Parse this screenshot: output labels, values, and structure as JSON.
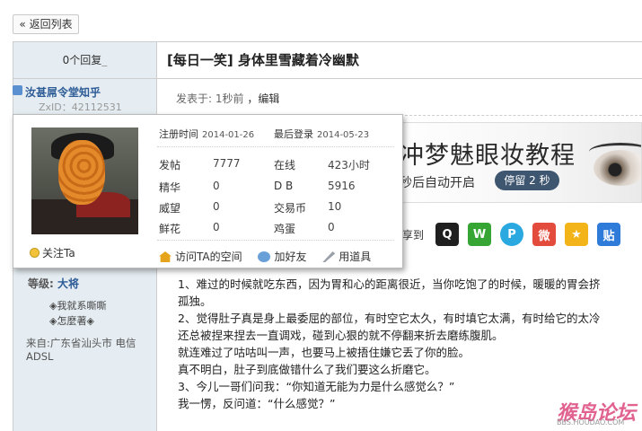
{
  "nav": {
    "back_label": "« 返回列表"
  },
  "thread": {
    "reply_count": "0个回复",
    "title": "[每日一笑] 身体里雪藏着冷幽默"
  },
  "user": {
    "name": "汝甚屌令堂知乎",
    "zxid": "ZxID：42112531",
    "rank_label": "等级:",
    "rank_value": "大将",
    "medals": [
      "◈我就系嘶嘶",
      "◈怎麼著◈"
    ],
    "from": "来自:广东省汕头市 电信ADSL"
  },
  "post": {
    "posted": "发表于: 1秒前",
    "edit": "，编辑",
    "share_label": "享到",
    "lines": [
      "1、难过的时候就吃东西，因为胃和心的距离很近，当你吃饱了的时候，暖暖的胃会挤",
      "孤独。",
      "2、觉得肚子真是身上最委屈的部位，有时空它太久，有时填它太满，有时给它的太冷",
      "还总被捏来捏去一直调戏，碰到心狠的就不停翻来折去磨练腹肌。",
      "就连难过了咕咕叫一声，也要马上被捂住嫌它丢了你的脸。",
      "真不明白，肚子到底做错什么了我们要这么折磨它。",
      "3、今儿一哥们问我：“你知道无能为力是什么感觉么？”",
      "我一愣，反问道：“什么感觉？”"
    ]
  },
  "ad": {
    "title": "冲梦魅眼妆教程",
    "subtitle": "秒后自动开启",
    "button": "停留 2 秒"
  },
  "share_icons": [
    {
      "name": "qq-share-icon",
      "glyph": "Q",
      "cls": "qq"
    },
    {
      "name": "wechat-share-icon",
      "glyph": "W",
      "cls": "wx"
    },
    {
      "name": "pengyou-share-icon",
      "glyph": "P",
      "cls": "pp"
    },
    {
      "name": "weibo-share-icon",
      "glyph": "微",
      "cls": "wb"
    },
    {
      "name": "qzone-share-icon",
      "glyph": "★",
      "cls": "st"
    },
    {
      "name": "tieba-share-icon",
      "glyph": "贴",
      "cls": "tb"
    }
  ],
  "card": {
    "follow": "关注Ta",
    "reg_label": "注册时间",
    "reg_value": "2014-01-26",
    "last_label": "最后登录",
    "last_value": "2014-05-23",
    "stats": [
      {
        "k1": "发帖",
        "v1": "7777",
        "k2": "在线",
        "v2": "423小时"
      },
      {
        "k1": "精华",
        "v1": "0",
        "k2": "D B",
        "v2": "5916"
      },
      {
        "k1": "威望",
        "v1": "0",
        "k2": "交易币",
        "v2": "10"
      },
      {
        "k1": "鲜花",
        "v1": "0",
        "k2": "鸡蛋",
        "v2": "0"
      }
    ],
    "links": [
      "访问TA的空间",
      "加好友",
      "用道具"
    ]
  },
  "watermark": {
    "main": "猴岛论坛",
    "sub": "BBS.HOUDAO.COM"
  }
}
